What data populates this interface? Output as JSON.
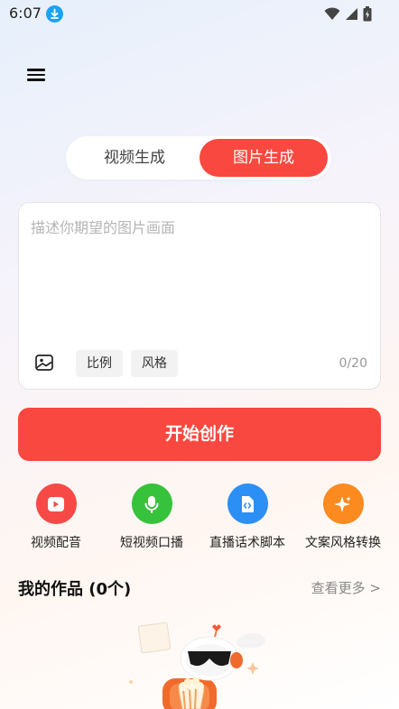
{
  "status_bar": {
    "time": "6:07"
  },
  "tabs": [
    {
      "label": "视频生成",
      "active": false
    },
    {
      "label": "图片生成",
      "active": true
    }
  ],
  "prompt": {
    "placeholder": "描述你期望的图片画面",
    "value": "",
    "chips": [
      "比例",
      "风格"
    ],
    "char_count": "0/20"
  },
  "start_button": {
    "label": "开始创作"
  },
  "features": [
    {
      "label": "视频配音",
      "icon": "video-dubbing-icon",
      "color": "#f74a46"
    },
    {
      "label": "短视频口播",
      "icon": "microphone-icon",
      "color": "#36c23a"
    },
    {
      "label": "直播话术脚本",
      "icon": "script-file-icon",
      "color": "#2b8ff6"
    },
    {
      "label": "文案风格转换",
      "icon": "sparkle-icon",
      "color": "#fb8a1f"
    }
  ],
  "works": {
    "title": "我的作品 (0个)",
    "see_more": "查看更多 >"
  },
  "colors": {
    "accent": "#f9483f",
    "status_blue": "#1aa3f0"
  }
}
